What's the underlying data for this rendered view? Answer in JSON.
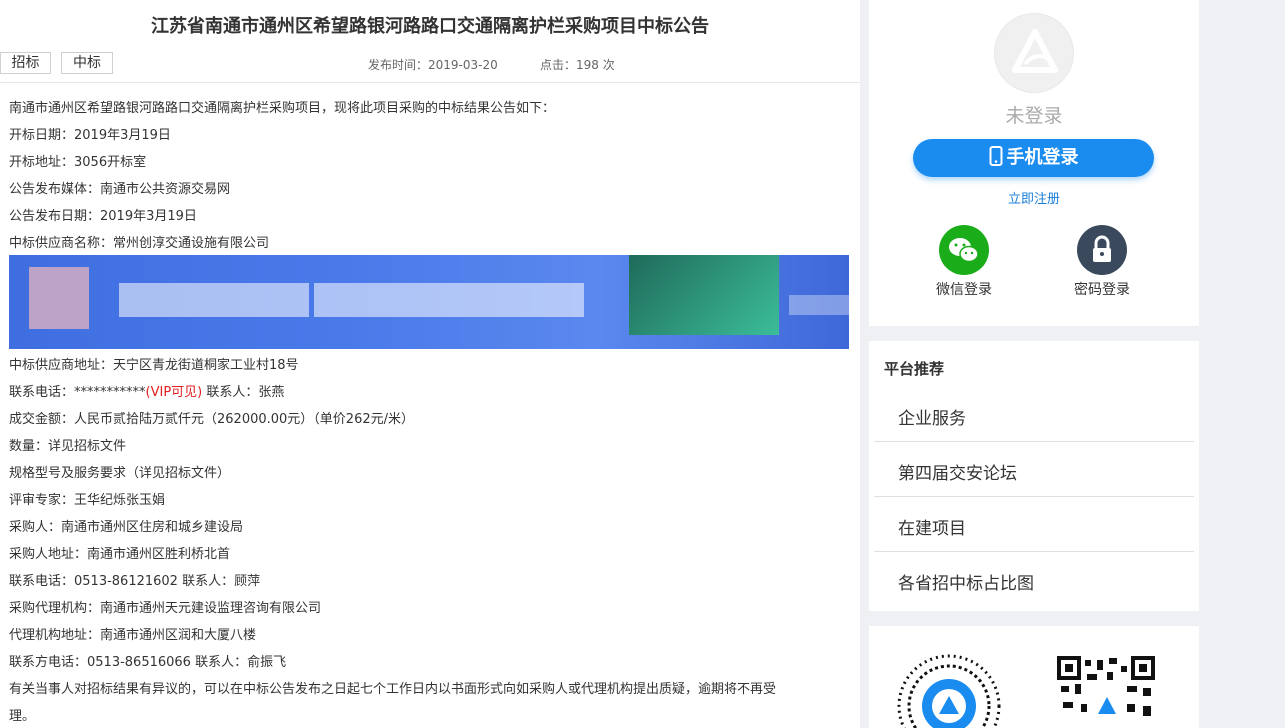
{
  "article": {
    "title": "江苏省南通市通州区希望路银河路路口交通隔离护栏采购项目中标公告",
    "tags": [
      "招标",
      "中标"
    ],
    "publish_time": "发布时间：2019-03-20",
    "clicks": "点击：198 次",
    "lines": [
      "南通市通州区希望路银河路路口交通隔离护栏采购项目，现将此项目采购的中标结果公告如下：",
      "开标日期：2019年3月19日",
      "开标地址：3056开标室",
      "公告发布媒体：南通市公共资源交易网",
      "公告发布日期：2019年3月19日",
      "中标供应商名称：常州创淳交通设施有限公司"
    ],
    "supplier_address": "中标供应商地址：天宁区青龙街道桐家工业村18号",
    "phone_prefix": "联系电话：***********",
    "phone_vip": "(VIP可见)",
    "phone_contact": " 联系人：张燕",
    "lines2": [
      "成交金额：人民币贰拾陆万贰仟元（262000.00元）（单价262元/米）",
      "数量：详见招标文件",
      "规格型号及服务要求（详见招标文件）",
      "评审专家：王华纪烁张玉娟",
      "采购人：南通市通州区住房和城乡建设局",
      "采购人地址：南通市通州区胜利桥北首",
      "联系电话：0513-86121602 联系人：顾萍",
      "采购代理机构：南通市通州天元建设监理咨询有限公司",
      "代理机构地址：南通市通州区润和大厦八楼",
      "联系方电话：0513-86516066 联系人：俞振飞",
      "有关当事人对招标结果有异议的，可以在中标公告发布之日起七个工作日内以书面形式向如采购人或代理机构提出质疑，逾期将不再受",
      "理。"
    ]
  },
  "login": {
    "status": "未登录",
    "phone_button": "手机登录",
    "register": "立即注册",
    "wechat": "微信登录",
    "password": "密码登录"
  },
  "recommend": {
    "title": "平台推荐",
    "items": [
      "企业服务",
      "第四届交安论坛",
      "在建项目",
      "各省招中标占比图"
    ]
  },
  "colors": {
    "accent": "#1a8cf0",
    "vip": "#e02020",
    "wechat": "#1aad19"
  },
  "icons": [
    "logo-icon",
    "phone-icon",
    "wechat-icon",
    "lock-icon",
    "qr-code-icon"
  ]
}
